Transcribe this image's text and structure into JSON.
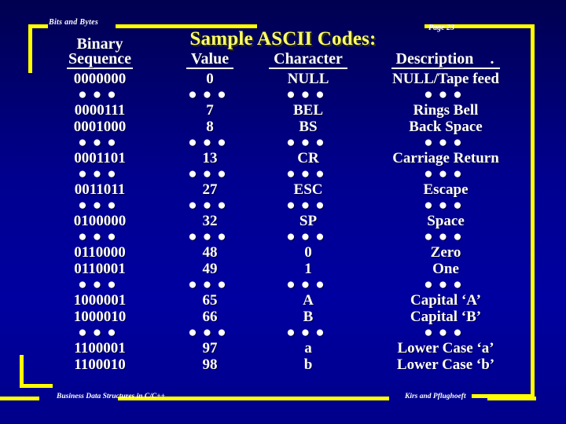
{
  "slide": {
    "kicker": "Bits and Bytes",
    "page_label": "Page 23",
    "title": "Sample ASCII Codes:",
    "background_color": "#00007f",
    "accent_color": "#ffff00",
    "title_color": "#ffff66",
    "text_color": "#ffffff"
  },
  "table": {
    "headers": {
      "binary_top": "Binary",
      "binary_bottom": "Sequence",
      "value": "Value",
      "character": "Character",
      "description": "Description",
      "description_trailing": "."
    },
    "ellipsis": "• • •",
    "rows": [
      {
        "type": "data",
        "binary": "0000000",
        "value": "0",
        "character": "NULL",
        "description": "NULL/Tape feed"
      },
      {
        "type": "sep"
      },
      {
        "type": "data",
        "binary": "0000111",
        "value": "7",
        "character": "BEL",
        "description": "Rings Bell"
      },
      {
        "type": "data",
        "binary": "0001000",
        "value": "8",
        "character": "BS",
        "description": "Back Space"
      },
      {
        "type": "sep"
      },
      {
        "type": "data",
        "binary": "0001101",
        "value": "13",
        "character": "CR",
        "description": "Carriage Return"
      },
      {
        "type": "sep"
      },
      {
        "type": "data",
        "binary": "0011011",
        "value": "27",
        "character": "ESC",
        "description": "Escape"
      },
      {
        "type": "sep"
      },
      {
        "type": "data",
        "binary": "0100000",
        "value": "32",
        "character": "SP",
        "description": "Space"
      },
      {
        "type": "sep"
      },
      {
        "type": "data",
        "binary": "0110000",
        "value": "48",
        "character": "0",
        "description": "Zero"
      },
      {
        "type": "data",
        "binary": "0110001",
        "value": "49",
        "character": "1",
        "description": "One"
      },
      {
        "type": "sep"
      },
      {
        "type": "data",
        "binary": "1000001",
        "value": "65",
        "character": "A",
        "description": "Capital ‘A’"
      },
      {
        "type": "data",
        "binary": "1000010",
        "value": "66",
        "character": "B",
        "description": "Capital ‘B’"
      },
      {
        "type": "sep"
      },
      {
        "type": "data",
        "binary": "1100001",
        "value": "97",
        "character": "a",
        "description": "Lower Case  ‘a’"
      },
      {
        "type": "data",
        "binary": "1100010",
        "value": "98",
        "character": "b",
        "description": "Lower Case  ‘b’"
      }
    ]
  },
  "footer": {
    "left": "Business Data Structures in C/C++",
    "right": "Kirs and Pflughoeft"
  }
}
